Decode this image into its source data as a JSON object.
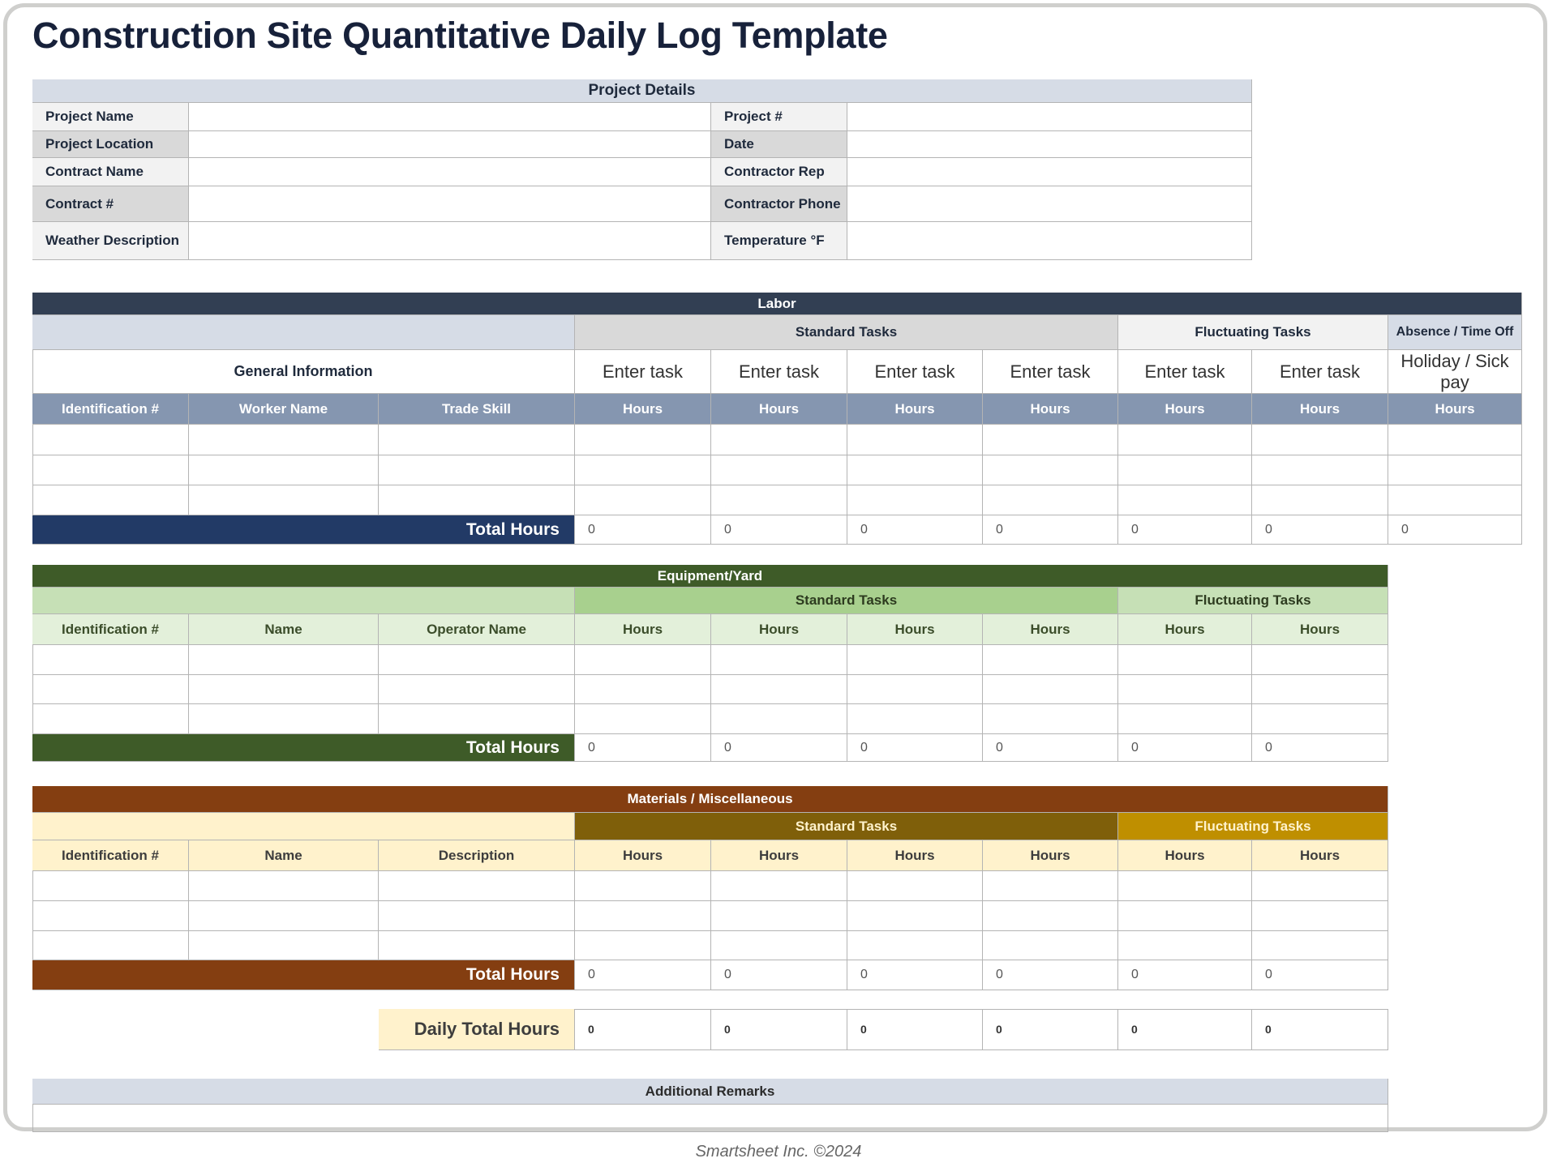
{
  "title": "Construction Site Quantitative Daily Log Template",
  "project_details": {
    "header": "Project Details",
    "left_fields": [
      {
        "label": "Project Name",
        "value": ""
      },
      {
        "label": "Project Location",
        "value": ""
      },
      {
        "label": "Contract Name",
        "value": ""
      },
      {
        "label": "Contract #",
        "value": ""
      },
      {
        "label": "Weather Description",
        "value": ""
      }
    ],
    "right_fields": [
      {
        "label": "Project #",
        "value": ""
      },
      {
        "label": "Date",
        "value": ""
      },
      {
        "label": "Contractor Rep",
        "value": ""
      },
      {
        "label": "Contractor Phone",
        "value": ""
      },
      {
        "label": "Temperature °F",
        "value": ""
      }
    ]
  },
  "labor": {
    "header": "Labor",
    "general_info": "General Information",
    "standard_tasks": "Standard Tasks",
    "fluctuating_tasks": "Fluctuating Tasks",
    "absence": "Absence / Time Off",
    "task_names": [
      "Enter task",
      "Enter task",
      "Enter task",
      "Enter task",
      "Enter task",
      "Enter task",
      "Holiday / Sick pay"
    ],
    "columns": [
      "Identification #",
      "Worker Name",
      "Trade Skill",
      "Hours",
      "Hours",
      "Hours",
      "Hours",
      "Hours",
      "Hours",
      "Hours"
    ],
    "rows": [
      [
        "",
        "",
        "",
        "",
        "",
        "",
        "",
        "",
        "",
        ""
      ],
      [
        "",
        "",
        "",
        "",
        "",
        "",
        "",
        "",
        "",
        ""
      ],
      [
        "",
        "",
        "",
        "",
        "",
        "",
        "",
        "",
        "",
        ""
      ]
    ],
    "total_label": "Total Hours",
    "totals": [
      "0",
      "0",
      "0",
      "0",
      "0",
      "0",
      "0"
    ],
    "colors": {
      "header": "#323f53",
      "subheader": "#d6dce6",
      "col_header": "#8596b0",
      "total": "#223a66"
    }
  },
  "equipment": {
    "header": "Equipment/Yard",
    "standard_tasks": "Standard Tasks",
    "fluctuating_tasks": "Fluctuating Tasks",
    "columns": [
      "Identification #",
      "Name",
      "Operator Name",
      "Hours",
      "Hours",
      "Hours",
      "Hours",
      "Hours",
      "Hours"
    ],
    "rows": [
      [
        "",
        "",
        "",
        "",
        "",
        "",
        "",
        "",
        ""
      ],
      [
        "",
        "",
        "",
        "",
        "",
        "",
        "",
        "",
        ""
      ],
      [
        "",
        "",
        "",
        "",
        "",
        "",
        "",
        "",
        ""
      ]
    ],
    "total_label": "Total Hours",
    "totals": [
      "0",
      "0",
      "0",
      "0",
      "0",
      "0"
    ],
    "colors": {
      "header": "#3e5b28",
      "subheader": "#c6e0b6",
      "standard": "#a8d08e",
      "col_header": "#e3f0da",
      "total": "#3e5b28"
    }
  },
  "materials": {
    "header": "Materials / Miscellaneous",
    "standard_tasks": "Standard Tasks",
    "fluctuating_tasks": "Fluctuating Tasks",
    "columns": [
      "Identification #",
      "Name",
      "Description",
      "Hours",
      "Hours",
      "Hours",
      "Hours",
      "Hours",
      "Hours"
    ],
    "rows": [
      [
        "",
        "",
        "",
        "",
        "",
        "",
        "",
        "",
        ""
      ],
      [
        "",
        "",
        "",
        "",
        "",
        "",
        "",
        "",
        ""
      ],
      [
        "",
        "",
        "",
        "",
        "",
        "",
        "",
        "",
        ""
      ]
    ],
    "total_label": "Total Hours",
    "totals": [
      "0",
      "0",
      "0",
      "0",
      "0",
      "0"
    ],
    "colors": {
      "header": "#843e11",
      "subheader": "#fff2cc",
      "standard": "#7f5f0a",
      "fluctuating": "#bf8f00",
      "col_header": "#fff2cc",
      "total": "#843e11"
    }
  },
  "daily_total": {
    "label": "Daily Total Hours",
    "values": [
      "0",
      "0",
      "0",
      "0",
      "0",
      "0"
    ]
  },
  "remarks": {
    "header": "Additional Remarks",
    "value": ""
  },
  "footer": "Smartsheet Inc. ©2024"
}
